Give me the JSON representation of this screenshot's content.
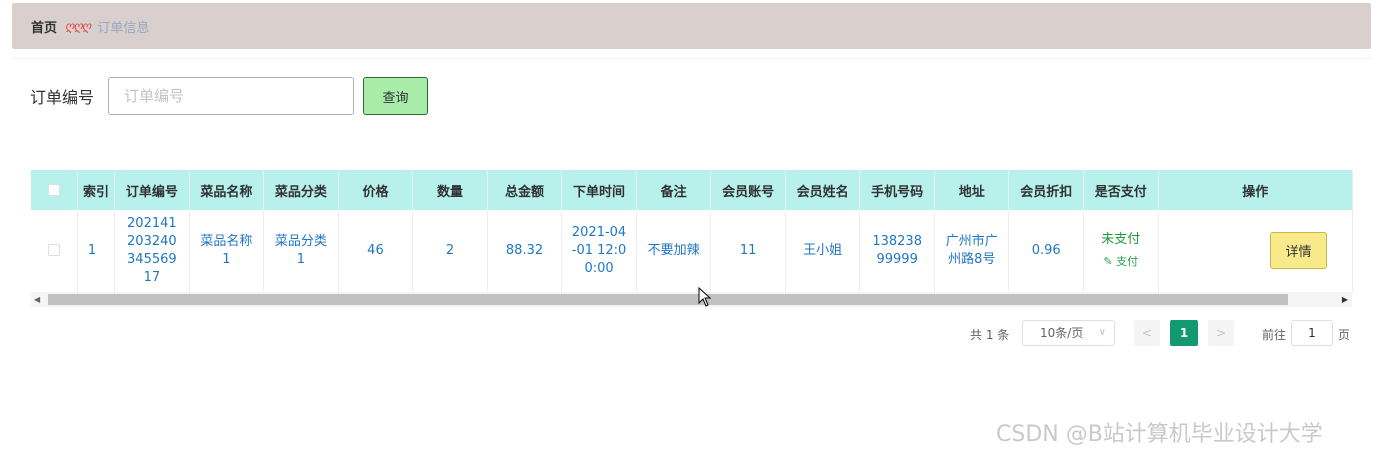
{
  "breadcrumb": {
    "home": "首页",
    "separator": "ღღღ",
    "current": "订单信息"
  },
  "search": {
    "label": "订单编号",
    "placeholder": "订单编号",
    "button": "查询"
  },
  "table": {
    "headers": [
      "索引",
      "订单编号",
      "菜品名称",
      "菜品分类",
      "价格",
      "数量",
      "总金额",
      "下单时间",
      "备注",
      "会员账号",
      "会员姓名",
      "手机号码",
      "地址",
      "会员折扣",
      "是否支付",
      "操作"
    ],
    "rows": [
      {
        "index": "1",
        "order_no": "20214120324034556917",
        "dish_name": "菜品名称1",
        "dish_category": "菜品分类1",
        "price": "46",
        "quantity": "2",
        "total": "88.32",
        "order_time": "2021-04-01 12:00:00",
        "note": "不要加辣",
        "member_account": "11",
        "member_name": "王小姐",
        "phone": "13823899999",
        "address": "广州市广州路8号",
        "discount": "0.96",
        "pay_status": "未支付",
        "pay_link": "支付",
        "action": "详情"
      }
    ]
  },
  "pagination": {
    "total": "共 1 条",
    "page_size": "10条/页",
    "current_page": "1",
    "goto_label": "前往",
    "goto_value": "1",
    "page_unit": "页"
  },
  "watermark": "CSDN @B站计算机毕业设计大学"
}
